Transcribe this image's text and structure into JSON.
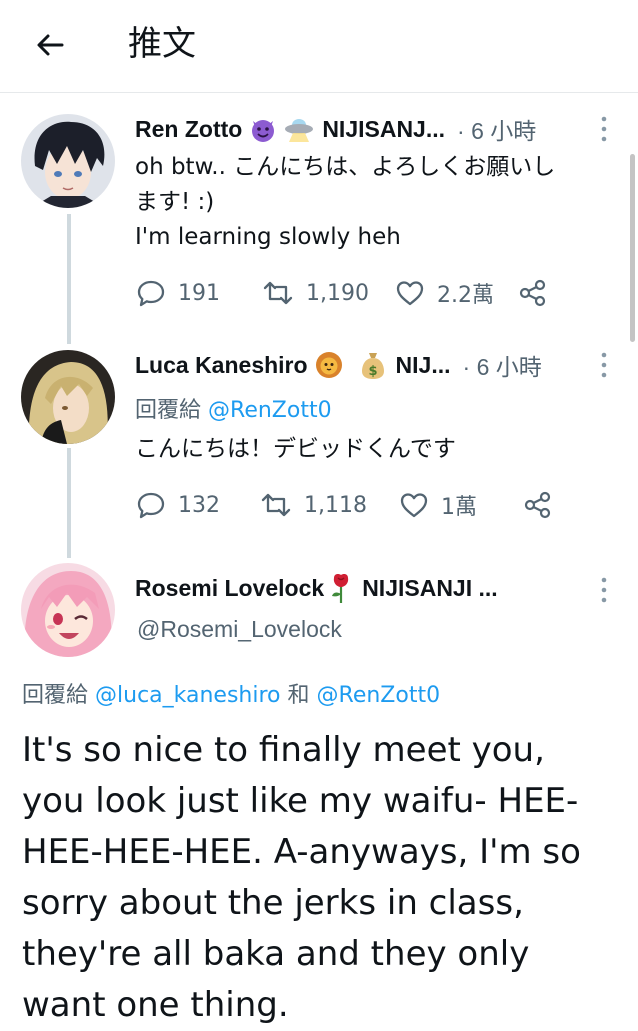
{
  "header": {
    "title": "推文"
  },
  "tweets": [
    {
      "name": "Ren Zotto",
      "emojis": [
        "smiling-imp-icon",
        "ufo-icon"
      ],
      "affiliation": "NIJISANJ...",
      "time": "· 6 小時",
      "text_lines": [
        "oh btw.. こんにちは、よろしくお願いし",
        "ます! :)",
        "I'm learning slowly heh"
      ],
      "replies": "191",
      "retweets": "1,190",
      "likes": "2.2萬"
    },
    {
      "name": "Luca Kaneshiro",
      "emojis": [
        "lion-icon",
        "money-bag-icon"
      ],
      "affiliation": "NIJ...",
      "time": "· 6 小時",
      "reply_prefix": "回覆給",
      "reply_handle": "@RenZott0",
      "text_lines": [
        "こんにちは！デビッドくんです"
      ],
      "replies": "132",
      "retweets": "1,118",
      "likes": "1萬"
    },
    {
      "name": "Rosemi Lovelock",
      "emojis": [
        "rose-icon"
      ],
      "affiliation": "NIJISANJI ...",
      "handle": "@Rosemi_Lovelock",
      "reply_prefix": "回覆給",
      "reply_handle_1": "@luca_kaneshiro",
      "reply_conj": "和",
      "reply_handle_2": "@RenZott0",
      "text_lines": [
        "It's so nice to finally meet you,",
        "you look just like my waifu- HEE-",
        "HEE-HEE-HEE. A-anyways, I'm so",
        "sorry about the jerks in class,",
        "they're all baka and they only",
        "want one thing."
      ]
    }
  ],
  "colors": {
    "link": "#1d9bf0",
    "muted": "#536471",
    "text": "#0f1419",
    "thread_line": "#cfd9de"
  }
}
